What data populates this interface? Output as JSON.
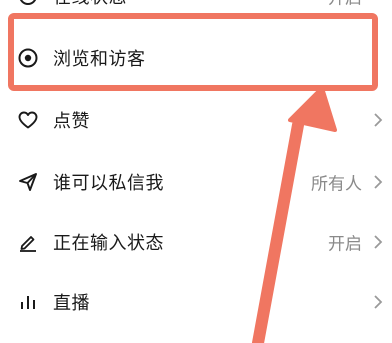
{
  "menu": {
    "items": [
      {
        "label": "在线状态",
        "value": "开启",
        "icon": "circle-status-icon"
      },
      {
        "label": "浏览和访客",
        "value": "",
        "icon": "eye-icon"
      },
      {
        "label": "点赞",
        "value": "",
        "icon": "heart-icon"
      },
      {
        "label": "谁可以私信我",
        "value": "所有人",
        "icon": "paper-plane-icon"
      },
      {
        "label": "正在输入状态",
        "value": "开启",
        "icon": "pencil-icon"
      },
      {
        "label": "直播",
        "value": "",
        "icon": "bar-chart-icon"
      }
    ]
  },
  "annotation": {
    "color": "#f07661",
    "target": "浏览和访客"
  }
}
